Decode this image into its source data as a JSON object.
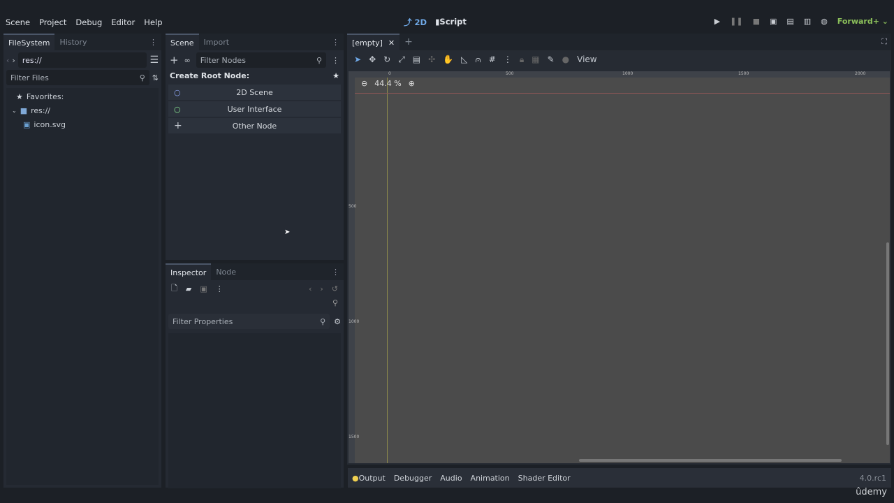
{
  "menu": [
    "Scene",
    "Project",
    "Debug",
    "Editor",
    "Help"
  ],
  "workspaces": {
    "w2d": "2D",
    "script": "Script"
  },
  "renderer": "Forward+",
  "filesystem": {
    "tabs": [
      "FileSystem",
      "History"
    ],
    "path": "res://",
    "filter_placeholder": "Filter Files",
    "favorites": "Favorites:",
    "root": "res://",
    "file": "icon.svg"
  },
  "scene": {
    "tabs": [
      "Scene",
      "Import"
    ],
    "filter_placeholder": "Filter Nodes",
    "create_root": "Create Root Node:",
    "buttons": [
      "2D Scene",
      "User Interface",
      "Other Node"
    ]
  },
  "inspector": {
    "tabs": [
      "Inspector",
      "Node"
    ],
    "filter_placeholder": "Filter Properties"
  },
  "viewport": {
    "tab": "[empty]",
    "view": "View",
    "zoom": "44.4 %",
    "ruler_h": [
      "0",
      "500",
      "1000",
      "1500",
      "2000"
    ],
    "ruler_v": [
      "500",
      "1000",
      "1500"
    ]
  },
  "bottom": {
    "tabs": [
      "Output",
      "Debugger",
      "Audio",
      "Animation",
      "Shader Editor"
    ],
    "version": "4.0.rc1"
  },
  "watermark": "ûdemy"
}
